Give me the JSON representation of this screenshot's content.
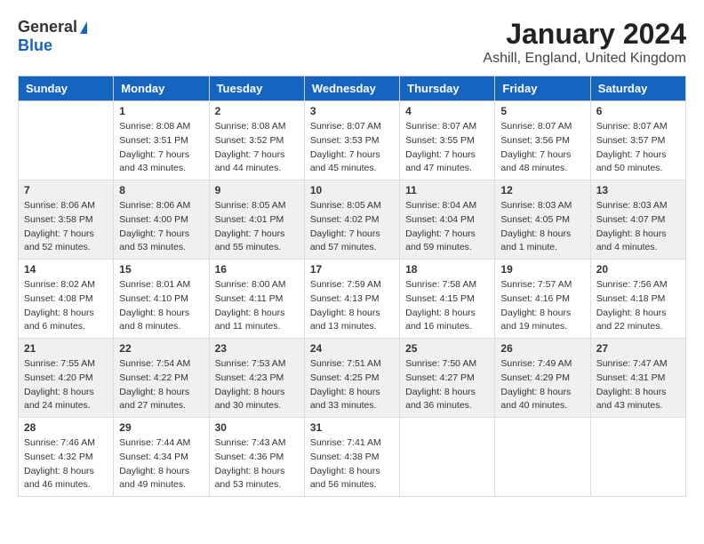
{
  "header": {
    "logo_general": "General",
    "logo_blue": "Blue",
    "month_year": "January 2024",
    "location": "Ashill, England, United Kingdom"
  },
  "days_of_week": [
    "Sunday",
    "Monday",
    "Tuesday",
    "Wednesday",
    "Thursday",
    "Friday",
    "Saturday"
  ],
  "weeks": [
    {
      "days": [
        {
          "number": "",
          "sunrise": "",
          "sunset": "",
          "daylight": ""
        },
        {
          "number": "1",
          "sunrise": "Sunrise: 8:08 AM",
          "sunset": "Sunset: 3:51 PM",
          "daylight": "Daylight: 7 hours and 43 minutes."
        },
        {
          "number": "2",
          "sunrise": "Sunrise: 8:08 AM",
          "sunset": "Sunset: 3:52 PM",
          "daylight": "Daylight: 7 hours and 44 minutes."
        },
        {
          "number": "3",
          "sunrise": "Sunrise: 8:07 AM",
          "sunset": "Sunset: 3:53 PM",
          "daylight": "Daylight: 7 hours and 45 minutes."
        },
        {
          "number": "4",
          "sunrise": "Sunrise: 8:07 AM",
          "sunset": "Sunset: 3:55 PM",
          "daylight": "Daylight: 7 hours and 47 minutes."
        },
        {
          "number": "5",
          "sunrise": "Sunrise: 8:07 AM",
          "sunset": "Sunset: 3:56 PM",
          "daylight": "Daylight: 7 hours and 48 minutes."
        },
        {
          "number": "6",
          "sunrise": "Sunrise: 8:07 AM",
          "sunset": "Sunset: 3:57 PM",
          "daylight": "Daylight: 7 hours and 50 minutes."
        }
      ]
    },
    {
      "days": [
        {
          "number": "7",
          "sunrise": "Sunrise: 8:06 AM",
          "sunset": "Sunset: 3:58 PM",
          "daylight": "Daylight: 7 hours and 52 minutes."
        },
        {
          "number": "8",
          "sunrise": "Sunrise: 8:06 AM",
          "sunset": "Sunset: 4:00 PM",
          "daylight": "Daylight: 7 hours and 53 minutes."
        },
        {
          "number": "9",
          "sunrise": "Sunrise: 8:05 AM",
          "sunset": "Sunset: 4:01 PM",
          "daylight": "Daylight: 7 hours and 55 minutes."
        },
        {
          "number": "10",
          "sunrise": "Sunrise: 8:05 AM",
          "sunset": "Sunset: 4:02 PM",
          "daylight": "Daylight: 7 hours and 57 minutes."
        },
        {
          "number": "11",
          "sunrise": "Sunrise: 8:04 AM",
          "sunset": "Sunset: 4:04 PM",
          "daylight": "Daylight: 7 hours and 59 minutes."
        },
        {
          "number": "12",
          "sunrise": "Sunrise: 8:03 AM",
          "sunset": "Sunset: 4:05 PM",
          "daylight": "Daylight: 8 hours and 1 minute."
        },
        {
          "number": "13",
          "sunrise": "Sunrise: 8:03 AM",
          "sunset": "Sunset: 4:07 PM",
          "daylight": "Daylight: 8 hours and 4 minutes."
        }
      ]
    },
    {
      "days": [
        {
          "number": "14",
          "sunrise": "Sunrise: 8:02 AM",
          "sunset": "Sunset: 4:08 PM",
          "daylight": "Daylight: 8 hours and 6 minutes."
        },
        {
          "number": "15",
          "sunrise": "Sunrise: 8:01 AM",
          "sunset": "Sunset: 4:10 PM",
          "daylight": "Daylight: 8 hours and 8 minutes."
        },
        {
          "number": "16",
          "sunrise": "Sunrise: 8:00 AM",
          "sunset": "Sunset: 4:11 PM",
          "daylight": "Daylight: 8 hours and 11 minutes."
        },
        {
          "number": "17",
          "sunrise": "Sunrise: 7:59 AM",
          "sunset": "Sunset: 4:13 PM",
          "daylight": "Daylight: 8 hours and 13 minutes."
        },
        {
          "number": "18",
          "sunrise": "Sunrise: 7:58 AM",
          "sunset": "Sunset: 4:15 PM",
          "daylight": "Daylight: 8 hours and 16 minutes."
        },
        {
          "number": "19",
          "sunrise": "Sunrise: 7:57 AM",
          "sunset": "Sunset: 4:16 PM",
          "daylight": "Daylight: 8 hours and 19 minutes."
        },
        {
          "number": "20",
          "sunrise": "Sunrise: 7:56 AM",
          "sunset": "Sunset: 4:18 PM",
          "daylight": "Daylight: 8 hours and 22 minutes."
        }
      ]
    },
    {
      "days": [
        {
          "number": "21",
          "sunrise": "Sunrise: 7:55 AM",
          "sunset": "Sunset: 4:20 PM",
          "daylight": "Daylight: 8 hours and 24 minutes."
        },
        {
          "number": "22",
          "sunrise": "Sunrise: 7:54 AM",
          "sunset": "Sunset: 4:22 PM",
          "daylight": "Daylight: 8 hours and 27 minutes."
        },
        {
          "number": "23",
          "sunrise": "Sunrise: 7:53 AM",
          "sunset": "Sunset: 4:23 PM",
          "daylight": "Daylight: 8 hours and 30 minutes."
        },
        {
          "number": "24",
          "sunrise": "Sunrise: 7:51 AM",
          "sunset": "Sunset: 4:25 PM",
          "daylight": "Daylight: 8 hours and 33 minutes."
        },
        {
          "number": "25",
          "sunrise": "Sunrise: 7:50 AM",
          "sunset": "Sunset: 4:27 PM",
          "daylight": "Daylight: 8 hours and 36 minutes."
        },
        {
          "number": "26",
          "sunrise": "Sunrise: 7:49 AM",
          "sunset": "Sunset: 4:29 PM",
          "daylight": "Daylight: 8 hours and 40 minutes."
        },
        {
          "number": "27",
          "sunrise": "Sunrise: 7:47 AM",
          "sunset": "Sunset: 4:31 PM",
          "daylight": "Daylight: 8 hours and 43 minutes."
        }
      ]
    },
    {
      "days": [
        {
          "number": "28",
          "sunrise": "Sunrise: 7:46 AM",
          "sunset": "Sunset: 4:32 PM",
          "daylight": "Daylight: 8 hours and 46 minutes."
        },
        {
          "number": "29",
          "sunrise": "Sunrise: 7:44 AM",
          "sunset": "Sunset: 4:34 PM",
          "daylight": "Daylight: 8 hours and 49 minutes."
        },
        {
          "number": "30",
          "sunrise": "Sunrise: 7:43 AM",
          "sunset": "Sunset: 4:36 PM",
          "daylight": "Daylight: 8 hours and 53 minutes."
        },
        {
          "number": "31",
          "sunrise": "Sunrise: 7:41 AM",
          "sunset": "Sunset: 4:38 PM",
          "daylight": "Daylight: 8 hours and 56 minutes."
        },
        {
          "number": "",
          "sunrise": "",
          "sunset": "",
          "daylight": ""
        },
        {
          "number": "",
          "sunrise": "",
          "sunset": "",
          "daylight": ""
        },
        {
          "number": "",
          "sunrise": "",
          "sunset": "",
          "daylight": ""
        }
      ]
    }
  ]
}
